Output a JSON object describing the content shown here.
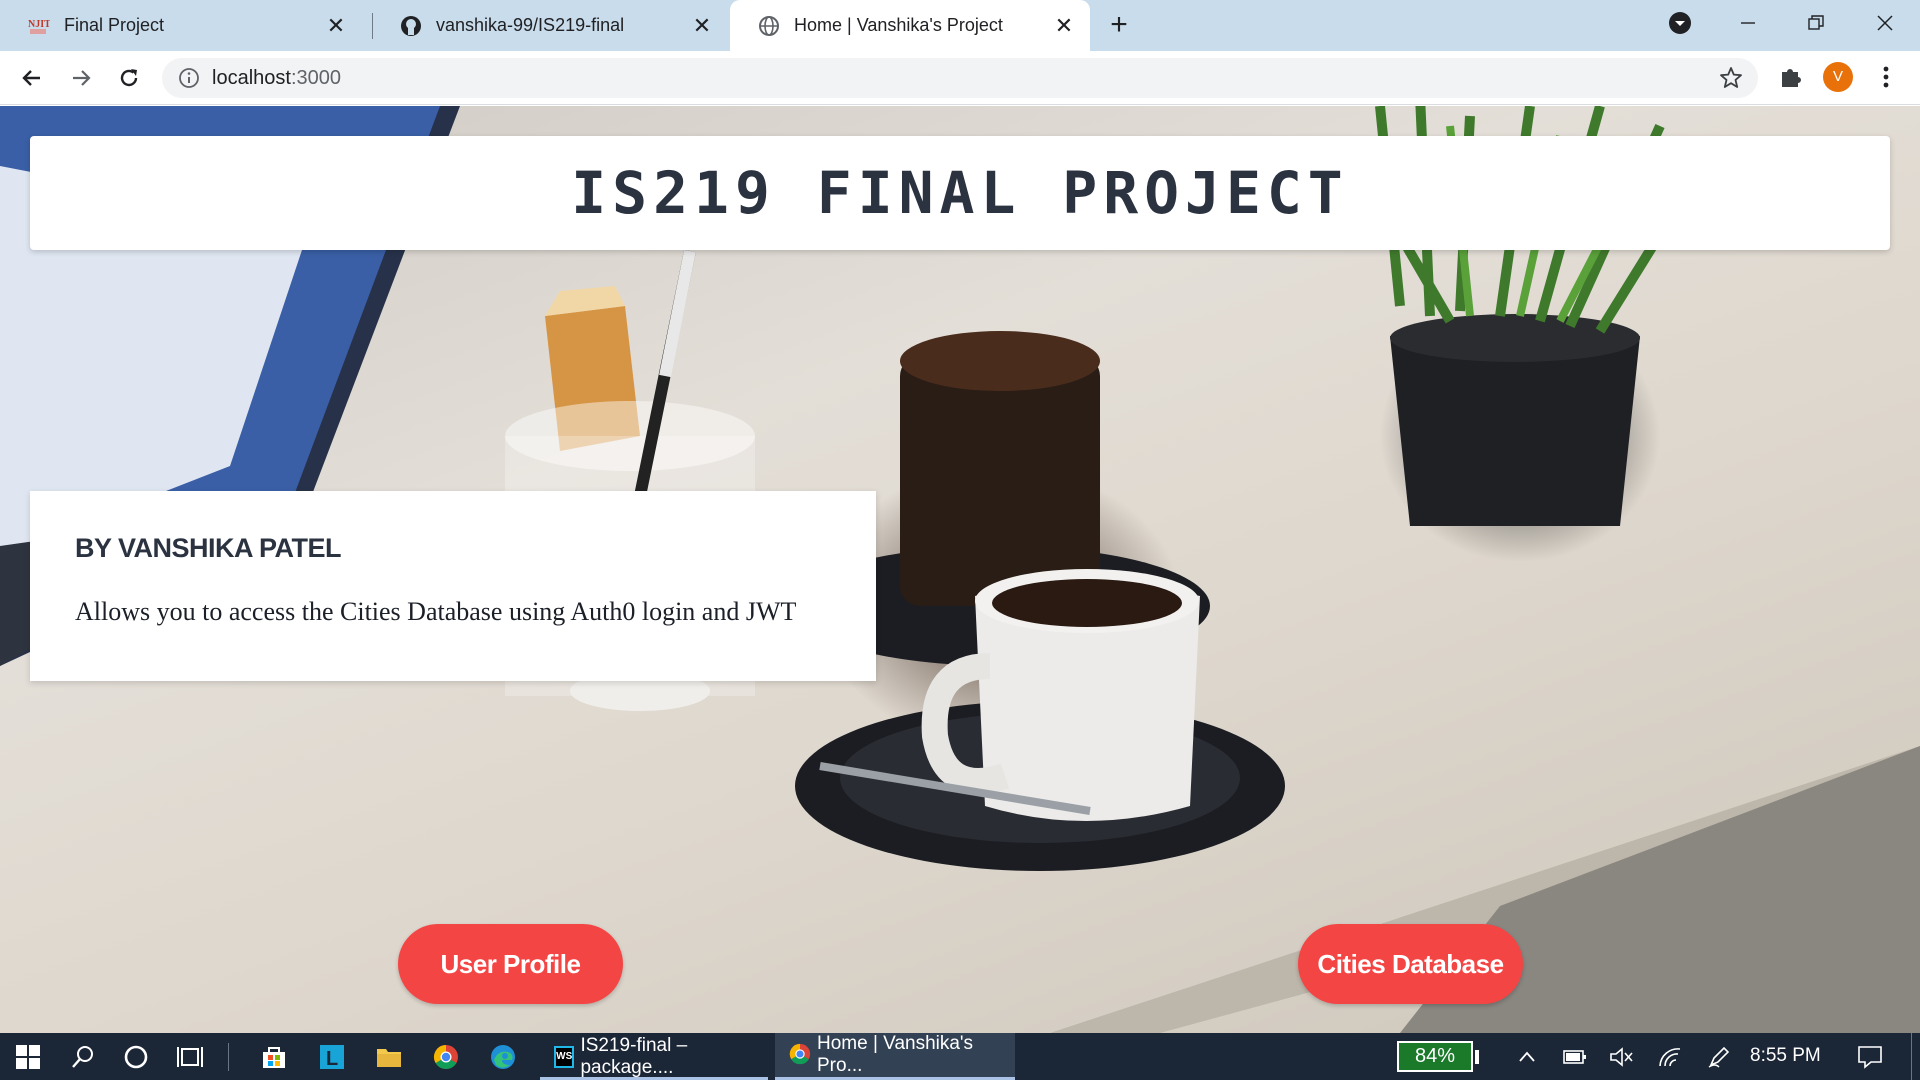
{
  "browser": {
    "tabs": [
      {
        "title": "Final Project",
        "favicon": "njit-logo-icon",
        "active": false
      },
      {
        "title": "vanshika-99/IS219-final",
        "favicon": "github-icon",
        "active": false
      },
      {
        "title": "Home | Vanshika's Project",
        "favicon": "globe-icon",
        "active": true
      }
    ],
    "url_host": "localhost",
    "url_port": ":3000",
    "profile_initial": "V",
    "profile_color": "#e8710a"
  },
  "page": {
    "header_title": "IS219 FINAL PROJECT",
    "byline": "BY VANSHIKA PATEL",
    "description": "Allows you to access the Cities Database using Auth0 login and JWT",
    "buttons": {
      "user_profile": "User Profile",
      "cities_database": "Cities Database"
    },
    "accent_color": "#f44545"
  },
  "taskbar": {
    "apps": [
      {
        "label": "IS219-final – package....",
        "icon": "webstorm-icon"
      },
      {
        "label": "Home | Vanshika's Pro...",
        "icon": "chrome-icon"
      }
    ],
    "battery": "84%",
    "clock": "8:55 PM"
  }
}
